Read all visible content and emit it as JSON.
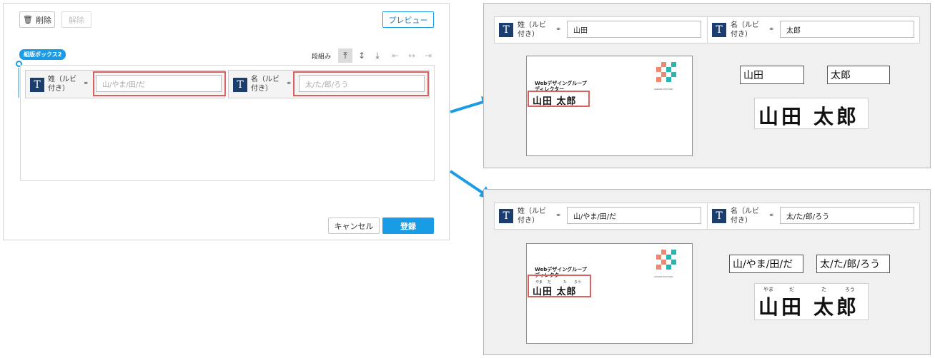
{
  "editor": {
    "delete_label": "削除",
    "release_label": "解除",
    "preview_label": "プレビュー",
    "group_tag": "組版ボックス2",
    "columns_label": "段組み",
    "field_sei_label_1": "姓（ルビ",
    "field_sei_label_2": "付き）",
    "field_sei_placeholder": "山/やま/田/だ",
    "field_mei_label_1": "名（ルビ",
    "field_mei_label_2": "付き）",
    "field_mei_placeholder": "太/た/郎/ろう",
    "cancel_label": "キャンセル",
    "register_label": "登録"
  },
  "preview1": {
    "sei_label_1": "姓（ルビ",
    "sei_label_2": "付き）",
    "sei_value": "山田",
    "mei_label_1": "名（ルビ",
    "mei_label_2": "付き）",
    "mei_value": "太郎",
    "card_company": "Webデザイングループ",
    "card_role": "ディレクター",
    "card_name": "山田 太郎",
    "logo_text": "SAKURA FACTORY",
    "out_sei": "山田",
    "out_mei": "太郎",
    "big_sei": "山田",
    "big_mei": "太郎"
  },
  "preview2": {
    "sei_label_1": "姓（ルビ",
    "sei_label_2": "付き）",
    "sei_value": "山/やま/田/だ",
    "mei_label_1": "名（ルビ",
    "mei_label_2": "付き）",
    "mei_value": "太/た/郎/ろう",
    "card_company": "Webデザイングループ",
    "card_role": "ディレクター",
    "card_name": "山田 太郎",
    "card_ruby_yama": "やま",
    "card_ruby_da": "だ",
    "card_ruby_ta": "た",
    "card_ruby_rou": "ろう",
    "logo_text": "SAKURA FACTORY",
    "out_sei": "山/やま/田/だ",
    "out_mei": "太/た/郎/ろう",
    "big_sei": "山田",
    "big_mei": "太郎",
    "big_ruby_yama": "やま",
    "big_ruby_da": "だ",
    "big_ruby_ta": "た",
    "big_ruby_rou": "ろう"
  },
  "colors": {
    "accent": "#1a9be6",
    "highlight": "#d9605c",
    "ticon": "#1b3e6e",
    "logo_teal": "#2ab5b0",
    "logo_coral": "#ee8870"
  }
}
